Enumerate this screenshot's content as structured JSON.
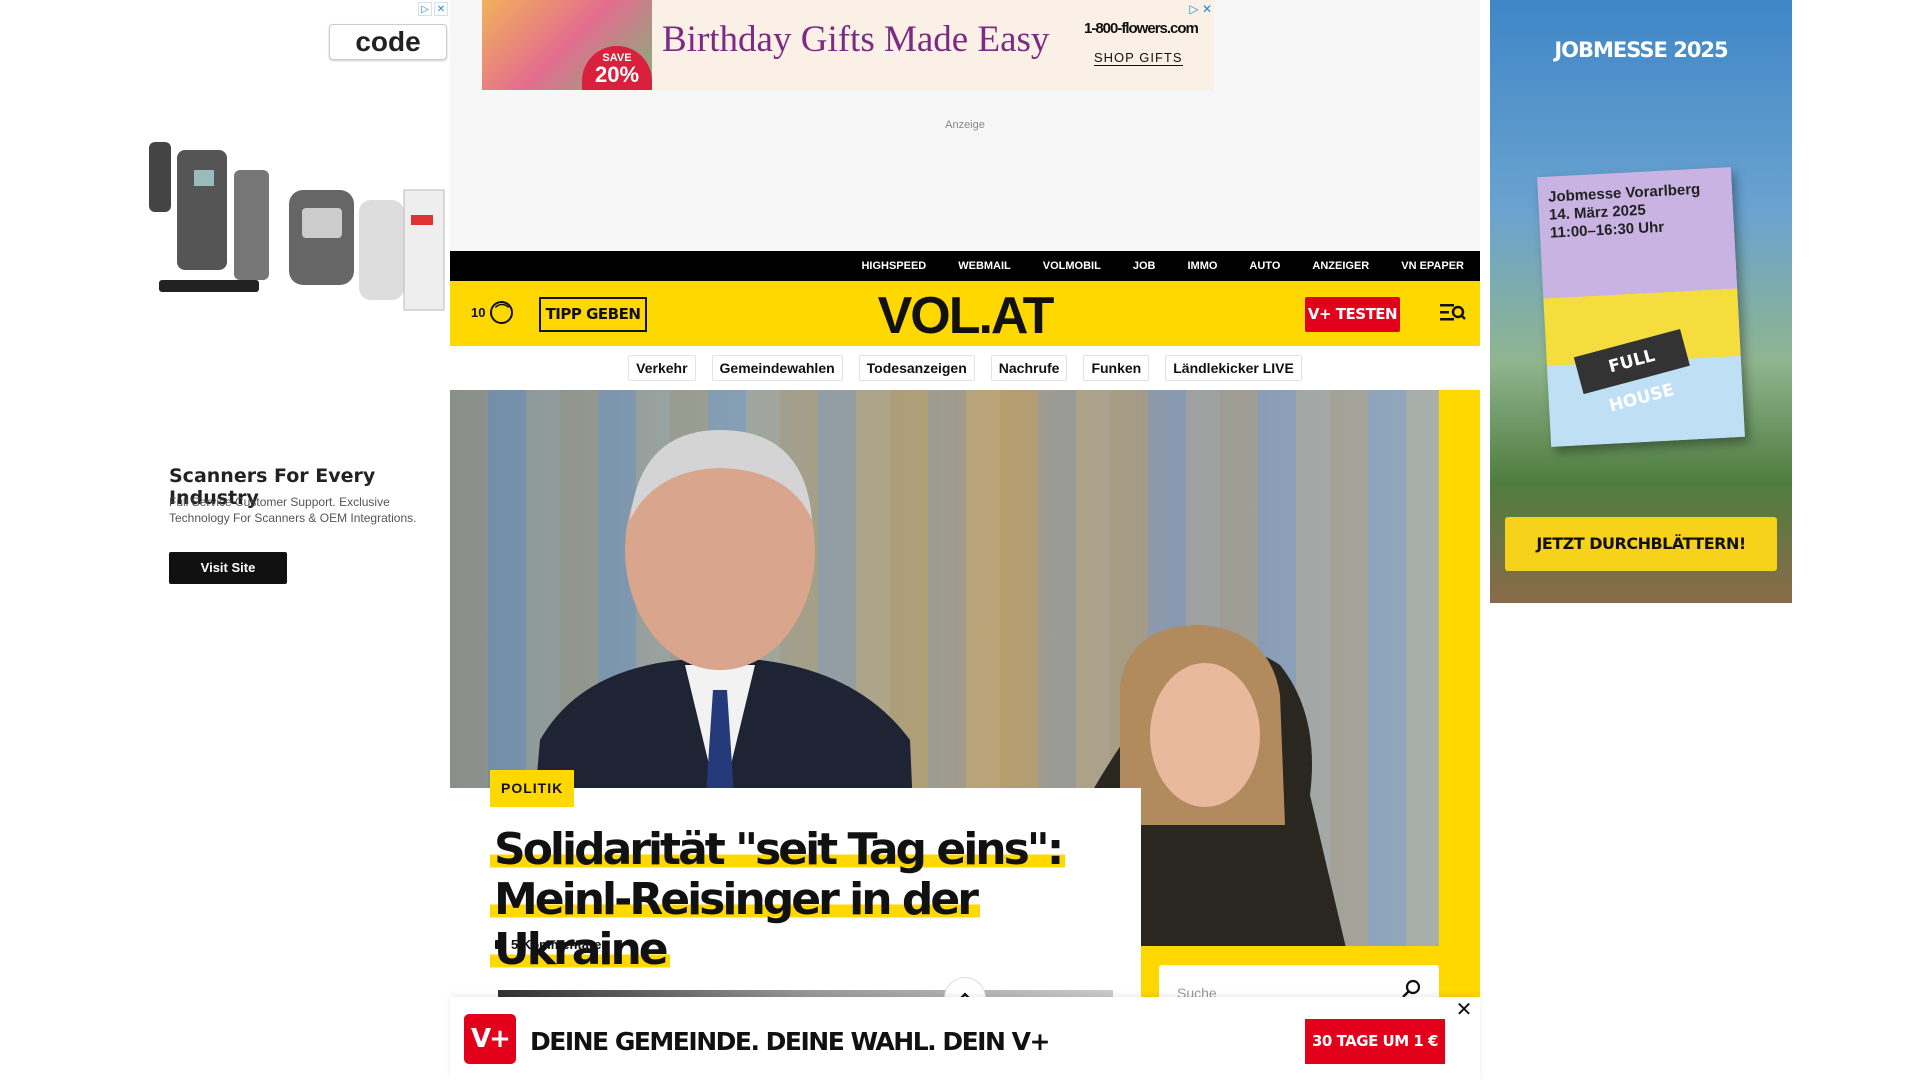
{
  "left_ad": {
    "brand": "code",
    "headline": "Scanners For Every Industry",
    "body": "Full Service Customer Support. Exclusive Technology For Scanners & OEM Integrations.",
    "button": "Visit Site"
  },
  "right_ad": {
    "title": "JOBMESSE 2025",
    "brochure_text": "Jobmesse Vorarlberg\n14. März 2025\n11:00–16:30 Uhr",
    "brochure_badge": "FULL HOUSE",
    "button": "JETZT DURCHBLÄTTERN!"
  },
  "top_banner": {
    "save_label": "SAVE",
    "save_value": "20%",
    "headline": "Birthday Gifts Made Easy",
    "brand": "1-800-flowers.com",
    "button": "SHOP GIFTS"
  },
  "ad_label": "Anzeige",
  "service_nav": [
    "HIGHSPEED",
    "WEBMAIL",
    "VOLMOBIL",
    "JOB",
    "IMMO",
    "AUTO",
    "ANZEIGER",
    "VN EPAPER"
  ],
  "header": {
    "notification_count": "10",
    "tipp_button": "TIPP GEBEN",
    "logo": "VOL.AT",
    "vplus_button": "V+ TESTEN"
  },
  "topics": [
    "Verkehr",
    "Gemeindewahlen",
    "Todesanzeigen",
    "Nachrufe",
    "Funken",
    "Ländlekicker LIVE"
  ],
  "hero": {
    "category": "POLITIK",
    "headline_line1": "Solidarität \"seit Tag eins\":",
    "headline_line2": "Meinl-Reisinger in der Ukraine",
    "comments": "5 Kommentare"
  },
  "search": {
    "placeholder": "Suche"
  },
  "sticky": {
    "logo": "V+",
    "slogan": "DEINE GEMEINDE. DEINE WAHL. DEIN V+",
    "button": "30 TAGE UM 1 €"
  },
  "colors": {
    "brand_yellow": "#ffd800",
    "brand_red": "#e2001a",
    "black": "#000000"
  }
}
